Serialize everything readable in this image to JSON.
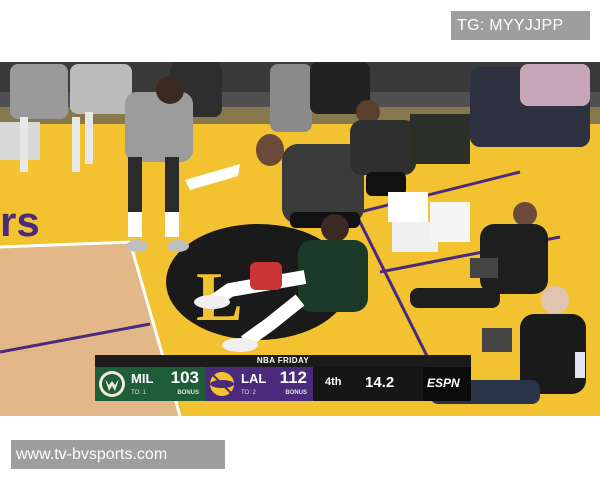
{
  "overlay": {
    "tg_label": "TG: MYYJJPP",
    "site_url": "www.tv-bvsports.com"
  },
  "scene": {
    "court_text": "rs",
    "center_logo_text": "L"
  },
  "scorebug": {
    "header": "NBA FRIDAY",
    "home": {
      "abbr": "MIL",
      "score": "103",
      "timeouts": "TO: 1",
      "bonus": "BONUS",
      "color": "#1f5c3a"
    },
    "away": {
      "abbr": "LAL",
      "score": "112",
      "timeouts": "TO: 2",
      "bonus": "BONUS",
      "color": "#4b2a7c"
    },
    "period": "4th",
    "clock": "14.2",
    "network": "ESPN"
  }
}
